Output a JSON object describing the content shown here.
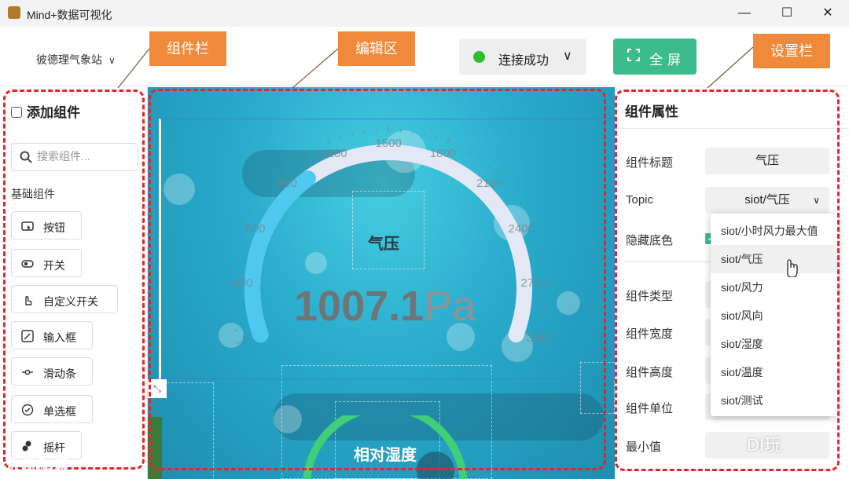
{
  "window": {
    "title": "Mind+数据可视化",
    "minimize": "—",
    "maximize": "☐",
    "close": "✕"
  },
  "toolbar": {
    "station": "彼德理气象站",
    "connection_status": "连接成功",
    "fullscreen_label": "全屏"
  },
  "callouts": {
    "components": "组件栏",
    "editor": "编辑区",
    "settings": "设置栏"
  },
  "left_panel": {
    "title": "添加组件",
    "search_placeholder": "搜索组件...",
    "section": "基础组件",
    "items": [
      {
        "label": "按钮",
        "icon": "button-icon"
      },
      {
        "label": "开关",
        "icon": "switch-icon"
      },
      {
        "label": "自定义开关",
        "icon": "hand-switch-icon"
      },
      {
        "label": "输入框",
        "icon": "input-icon"
      },
      {
        "label": "滑动条",
        "icon": "slider-icon"
      },
      {
        "label": "单选框",
        "icon": "radio-icon"
      },
      {
        "label": "摇杆",
        "icon": "joystick-icon"
      }
    ]
  },
  "canvas": {
    "gauge": {
      "title": "气压",
      "value": "1007.1",
      "unit": "Pa",
      "min": 0,
      "max": 3000,
      "ticks": [
        "0",
        "300",
        "600",
        "900",
        "1200",
        "1500",
        "1800",
        "2100",
        "2400",
        "2700",
        "3000"
      ]
    },
    "humidity_title": "相对湿度"
  },
  "right_panel": {
    "title": "组件属性",
    "props": [
      {
        "label": "组件标题",
        "value": "气压"
      },
      {
        "label": "Topic",
        "value": "siot/气压"
      },
      {
        "label": "隐藏底色",
        "value": ""
      },
      {
        "label": "组件类型",
        "value": ""
      },
      {
        "label": "组件宽度",
        "value": ""
      },
      {
        "label": "组件高度",
        "value": ""
      },
      {
        "label": "组件单位",
        "value": ""
      },
      {
        "label": "最小值",
        "value": ""
      }
    ],
    "topic_options": [
      "siot/小时风力最大值",
      "siot/气压",
      "siot/风力",
      "siot/风向",
      "siot/湿度",
      "siot/温度",
      "siot/测试"
    ],
    "topic_selected": "siot/气压"
  },
  "watermarks": {
    "left": "大数跨境",
    "right": "DI玩"
  },
  "colors": {
    "accent": "#3cbc8c",
    "callout": "#f08a3a",
    "region_border": "#e3262a",
    "status_ok": "#2bc02b",
    "gauge_fill": "#4fc8f0"
  }
}
